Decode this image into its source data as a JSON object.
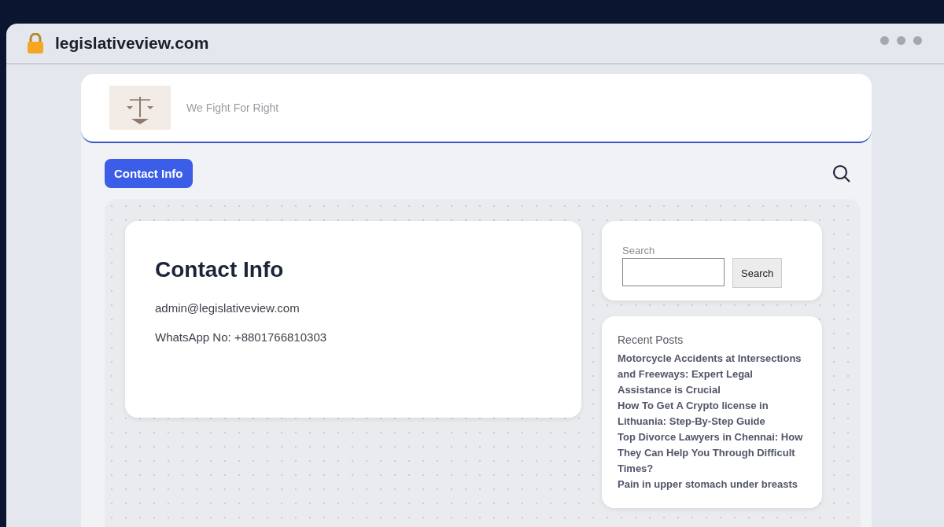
{
  "browser": {
    "url": "legislativeview.com"
  },
  "header": {
    "tagline": "We Fight For Right"
  },
  "nav": {
    "button": "Contact Info"
  },
  "content": {
    "title": "Contact Info",
    "lines": [
      "admin@legislativeview.com",
      "WhatsApp No: +8801766810303"
    ]
  },
  "search_widget": {
    "label": "Search",
    "button": "Search"
  },
  "recent_posts": {
    "title": "Recent Posts",
    "posts": [
      "Motorcycle Accidents at Intersections and Freeways: Expert Legal Assistance is Crucial",
      "How To Get A Crypto license in Lithuania: Step-By-Step Guide",
      "Top Divorce Lawyers in Chennai: How They Can Help You Through Difficult Times?",
      "Pain in upper stomach under breasts"
    ]
  }
}
